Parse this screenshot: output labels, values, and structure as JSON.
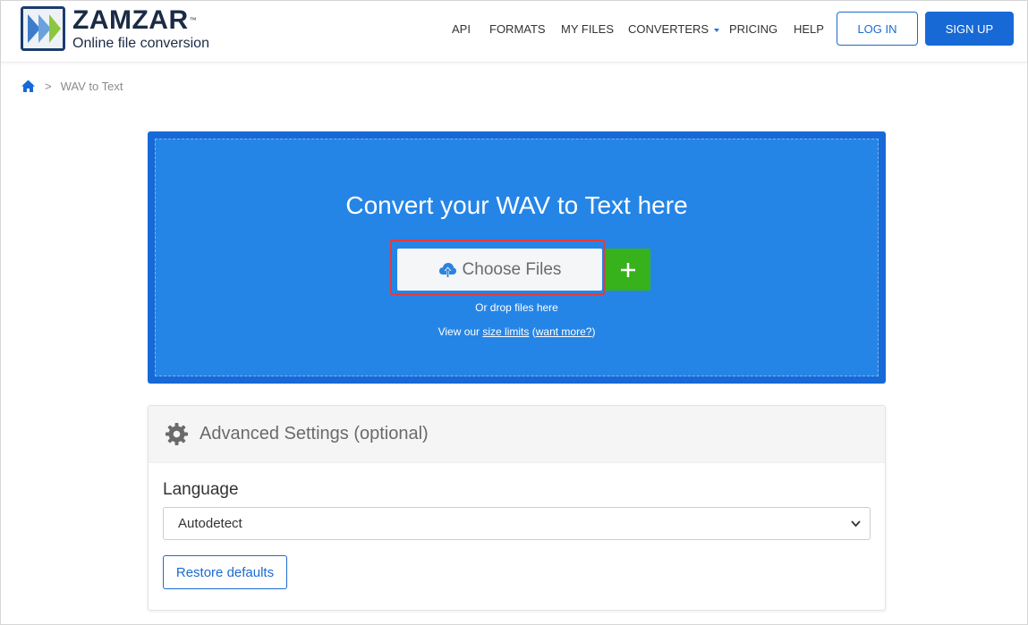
{
  "brand": {
    "name": "ZAMZAR",
    "trademark": "™",
    "tagline": "Online file conversion"
  },
  "nav": {
    "api": "API",
    "formats": "FORMATS",
    "my_files": "MY FILES",
    "converters": "CONVERTERS",
    "pricing": "PRICING",
    "help": "HELP",
    "login": "LOG IN",
    "signup": "SIGN UP"
  },
  "breadcrumb": {
    "separator": ">",
    "current": "WAV to Text"
  },
  "converter": {
    "title": "Convert your WAV to Text here",
    "choose_files": "Choose Files",
    "add_more": "+",
    "drop_text": "Or drop files here",
    "limits_prefix": "View our ",
    "size_limits": "size limits",
    "paren_open": " (",
    "want_more": "want more?",
    "paren_close": ")"
  },
  "settings": {
    "title": "Advanced Settings (optional)",
    "language_label": "Language",
    "language_value": "Autodetect",
    "restore": "Restore defaults"
  },
  "colors": {
    "brand_blue": "#1769d6",
    "drop_zone": "#2585e6",
    "add_green": "#37b21c",
    "highlight_red": "#e53b3b"
  }
}
